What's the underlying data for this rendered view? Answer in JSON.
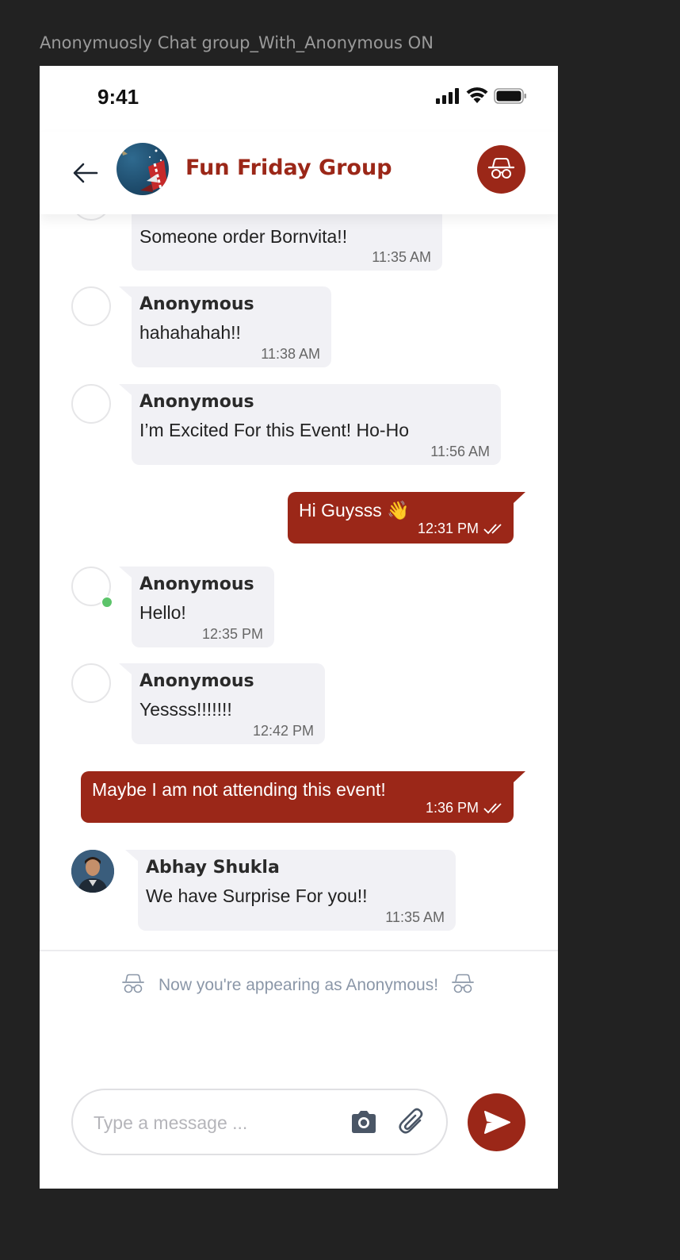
{
  "frame_label": "Anonymuosly Chat group_With_Anonymous ON",
  "status_bar": {
    "time": "9:41"
  },
  "header": {
    "title": "Fun Friday Group"
  },
  "messages": [
    {
      "text": "Someone order Bornvita!!",
      "time": "11:35 AM"
    },
    {
      "sender": "Anonymous",
      "text": "hahahahah!!",
      "time": "11:38 AM"
    },
    {
      "sender": "Anonymous",
      "text": "I’m Excited For this Event! Ho-Ho",
      "time": "11:56 AM"
    },
    {
      "text": "Hi Guysss 👋",
      "time": "12:31 PM"
    },
    {
      "sender": "Anonymous",
      "text": "Hello!",
      "time": "12:35 PM"
    },
    {
      "sender": "Anonymous",
      "text": "Yessss!!!!!!!",
      "time": "12:42 PM"
    },
    {
      "text": "Maybe I am not attending this event!",
      "time": "1:36 PM"
    },
    {
      "sender": "Abhay Shukla",
      "text": "We have Surprise For you!!",
      "time": "11:35 AM"
    }
  ],
  "notice": {
    "text": "Now you're appearing as Anonymous!"
  },
  "composer": {
    "placeholder": "Type a message ..."
  },
  "colors": {
    "accent": "#9b2718",
    "bubble": "#f1f1f5",
    "online": "#5cc46a"
  },
  "icons": [
    "back-arrow-icon",
    "incognito-icon",
    "camera-icon",
    "paperclip-icon",
    "send-icon",
    "double-check-icon"
  ]
}
